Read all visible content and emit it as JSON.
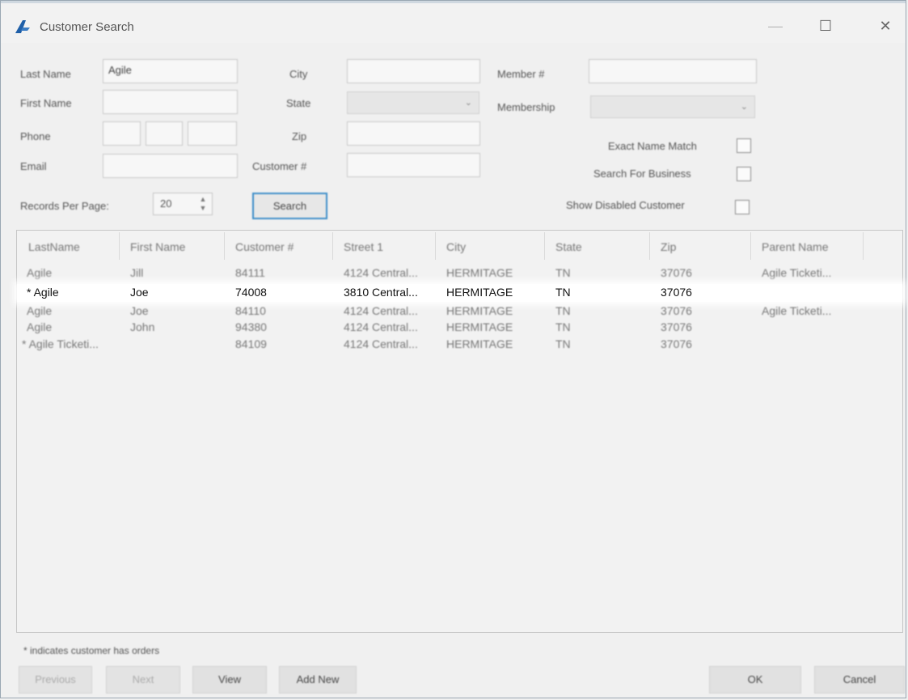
{
  "window": {
    "title": "Customer Search",
    "minimize_glyph": "—",
    "maximize_glyph": "☐",
    "close_glyph": "✕",
    "icon": "app-logo-icon",
    "accent_color": "#1f5fa8"
  },
  "form": {
    "last_name_label": "Last Name",
    "last_name_value": "Agile",
    "first_name_label": "First Name",
    "first_name_value": "",
    "phone_label": "Phone",
    "email_label": "Email",
    "email_value": "",
    "city_label": "City",
    "city_value": "",
    "state_label": "State",
    "state_value": "",
    "zip_label": "Zip",
    "zip_value": "",
    "customer_no_label": "Customer #",
    "customer_no_value": "",
    "member_no_label": "Member #",
    "member_no_value": "",
    "membership_label": "Membership",
    "membership_value": "",
    "exact_name_match_label": "Exact Name Match",
    "search_for_business_label": "Search For Business",
    "show_disabled_label": "Show Disabled Customer",
    "records_per_page_label": "Records Per Page:",
    "records_per_page_value": "20",
    "search_button": "Search"
  },
  "grid": {
    "columns": [
      "LastName",
      "First Name",
      "Customer #",
      "Street 1",
      "City",
      "State",
      "Zip",
      "Parent Name"
    ],
    "rows": [
      [
        "Agile",
        "Jill",
        "84111",
        "4124 Central...",
        "HERMITAGE",
        "TN",
        "37076",
        "Agile Ticketi..."
      ],
      [
        "* Agile",
        "Joe",
        "74008",
        "3810 Central...",
        "HERMITAGE",
        "TN",
        "37076",
        ""
      ],
      [
        "Agile",
        "Joe",
        "84110",
        "4124 Central...",
        "HERMITAGE",
        "TN",
        "37076",
        "Agile Ticketi..."
      ],
      [
        "Agile",
        "John",
        "94380",
        "4124 Central...",
        "HERMITAGE",
        "TN",
        "37076",
        ""
      ],
      [
        "* Agile Ticketi...",
        "",
        "84109",
        "4124 Central...",
        "HERMITAGE",
        "TN",
        "37076",
        ""
      ]
    ],
    "selected_row_index": 1
  },
  "footnote": "* indicates customer has orders",
  "buttons": {
    "previous": "Previous",
    "next": "Next",
    "view": "View",
    "add_new": "Add New",
    "ok": "OK",
    "cancel": "Cancel"
  }
}
